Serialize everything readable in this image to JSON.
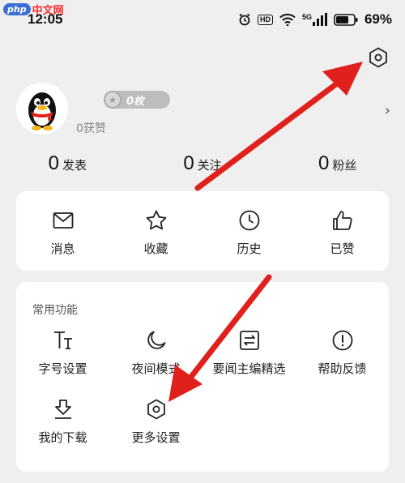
{
  "watermark": {
    "badge": "php",
    "text": "中文网"
  },
  "status_bar": {
    "time": "12:05",
    "hd": "HD",
    "network": "5G",
    "battery": "69%"
  },
  "profile": {
    "coin_count": "0枚",
    "likes": "0获赞"
  },
  "stats": [
    {
      "value": "0",
      "label": "发表"
    },
    {
      "value": "0",
      "label": "关注"
    },
    {
      "value": "0",
      "label": "粉丝"
    }
  ],
  "quick_actions": [
    {
      "label": "消息",
      "icon": "mail-icon"
    },
    {
      "label": "收藏",
      "icon": "star-icon"
    },
    {
      "label": "历史",
      "icon": "clock-icon"
    },
    {
      "label": "已赞",
      "icon": "thumbs-up-icon"
    }
  ],
  "functions": {
    "title": "常用功能",
    "items": [
      {
        "label": "字号设置",
        "icon": "font-size-icon"
      },
      {
        "label": "夜间模式",
        "icon": "moon-icon"
      },
      {
        "label": "要闻主编精选",
        "icon": "editor-picks-icon"
      },
      {
        "label": "帮助反馈",
        "icon": "help-icon"
      },
      {
        "label": "我的下载",
        "icon": "download-icon"
      },
      {
        "label": "更多设置",
        "icon": "settings-hexagon-icon"
      }
    ]
  },
  "colors": {
    "background": "#efefef",
    "card": "#ffffff",
    "arrow": "#e0201c"
  }
}
